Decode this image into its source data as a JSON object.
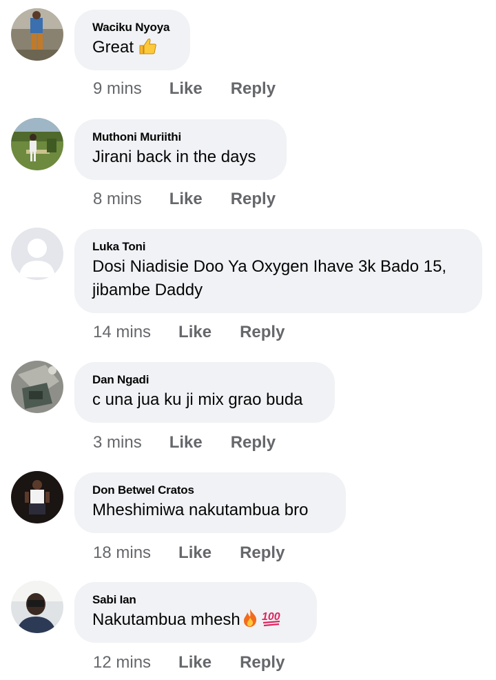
{
  "comments": [
    {
      "author": "Waciku Nyoya",
      "text": "Great",
      "time": "9 mins",
      "like": "Like",
      "reply": "Reply",
      "emoji": [
        "thumbs-up-icon"
      ]
    },
    {
      "author": "Muthoni Muriithi",
      "text": "Jirani back in the days",
      "time": "8 mins",
      "like": "Like",
      "reply": "Reply"
    },
    {
      "author": "Luka Toni",
      "text": "Dosi Niadisie Doo Ya Oxygen Ihave 3k Bado 15, jibambe Daddy",
      "time": "14 mins",
      "like": "Like",
      "reply": "Reply"
    },
    {
      "author": "Dan Ngadi",
      "text": "c una jua ku ji mix grao buda",
      "time": "3 mins",
      "like": "Like",
      "reply": "Reply"
    },
    {
      "author": "Don Betwel Cratos",
      "text": "Mheshimiwa nakutambua bro",
      "time": "18 mins",
      "like": "Like",
      "reply": "Reply"
    },
    {
      "author": "Sabi Ian",
      "text": "Nakutambua mhesh",
      "time": "12 mins",
      "like": "Like",
      "reply": "Reply",
      "emoji": [
        "fire-icon",
        "hundred-points-icon"
      ]
    }
  ],
  "colors": {
    "bubble": "#f0f2f5",
    "meta_text": "#65676b",
    "primary_text": "#050505"
  }
}
